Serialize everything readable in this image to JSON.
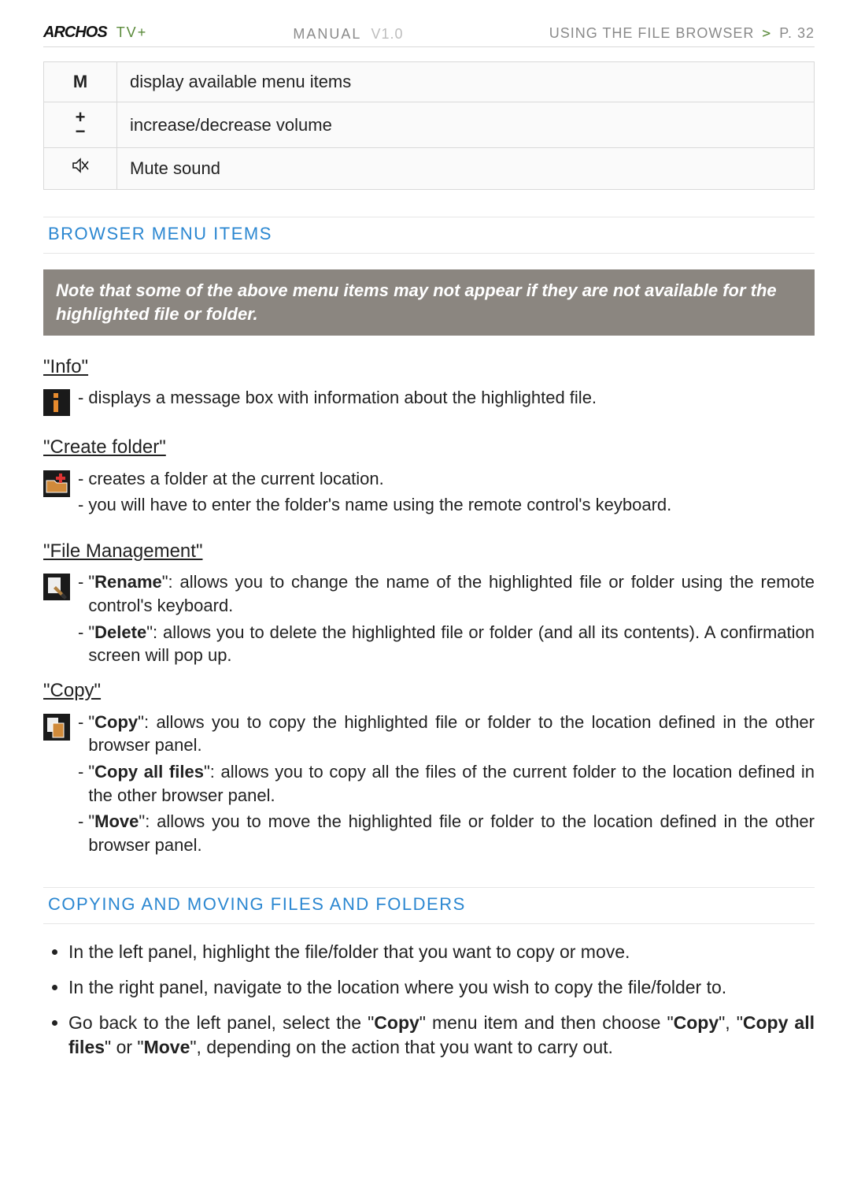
{
  "header": {
    "brand": "ARCHOS",
    "brand_suffix": "TV+",
    "manual_label": "MANUAL",
    "manual_version": "V1.0",
    "breadcrumb": "USING THE FILE BROWSER",
    "arrow": ">",
    "page_label": "P. 32"
  },
  "button_table": [
    {
      "key": "M",
      "desc": "display available menu items"
    },
    {
      "key_plus": "+",
      "key_minus": "−",
      "desc": "increase/decrease volume"
    },
    {
      "mute_icon": "mute",
      "desc": "Mute sound"
    }
  ],
  "sections": {
    "browser_menu_title": "BROWSER MENU ITEMS",
    "note": "Note that some of the above menu items may not appear if they are not available for the highlighted file or folder.",
    "info_title": "\"Info\"",
    "info_desc": "displays a message box with information about the highlighted file.",
    "create_title": "\"Create folder\"",
    "create_l1": "creates a folder at the current location.",
    "create_l2": "you will have to enter the folder's name using the remote control's keyboard.",
    "fm_title": "\"File Management\"",
    "fm_rename_pre": "\"",
    "fm_rename_b": "Rename",
    "fm_rename_post": "\": allows you to change the name of the highlighted file or folder using the remote control's keyboard.",
    "fm_delete_pre": "\"",
    "fm_delete_b": "Delete",
    "fm_delete_post": "\": allows you to delete the highlighted file or folder (and all its contents). A confirmation screen will pop up.",
    "copy_title": "\"Copy\"",
    "copy_copy_pre": "\"",
    "copy_copy_b": "Copy",
    "copy_copy_post": "\": allows you to copy the highlighted file or folder to the location defined in the other browser panel.",
    "copy_all_pre": "\"",
    "copy_all_b": "Copy all files",
    "copy_all_post": "\": allows you to copy all the files of the current folder to the location defined in the other browser panel.",
    "copy_move_pre": "\"",
    "copy_move_b": "Move",
    "copy_move_post": "\": allows you to move the highlighted file or folder to the location defined in the other browser panel.",
    "copying_title": "COPYING AND MOVING FILES AND FOLDERS",
    "step1": "In the left panel, highlight the file/folder that you want to copy or move.",
    "step2": "In the right panel, navigate to the location where you wish to copy the file/folder to.",
    "step3_a": "Go back to the left panel, select the \"",
    "step3_b1": "Copy",
    "step3_c": "\" menu item and then choose \"",
    "step3_b2": "Copy",
    "step3_d": "\", \"",
    "step3_b3": "Copy all files",
    "step3_e": "\" or \"",
    "step3_b4": "Move",
    "step3_f": "\", depending on the action that you want to carry out."
  }
}
